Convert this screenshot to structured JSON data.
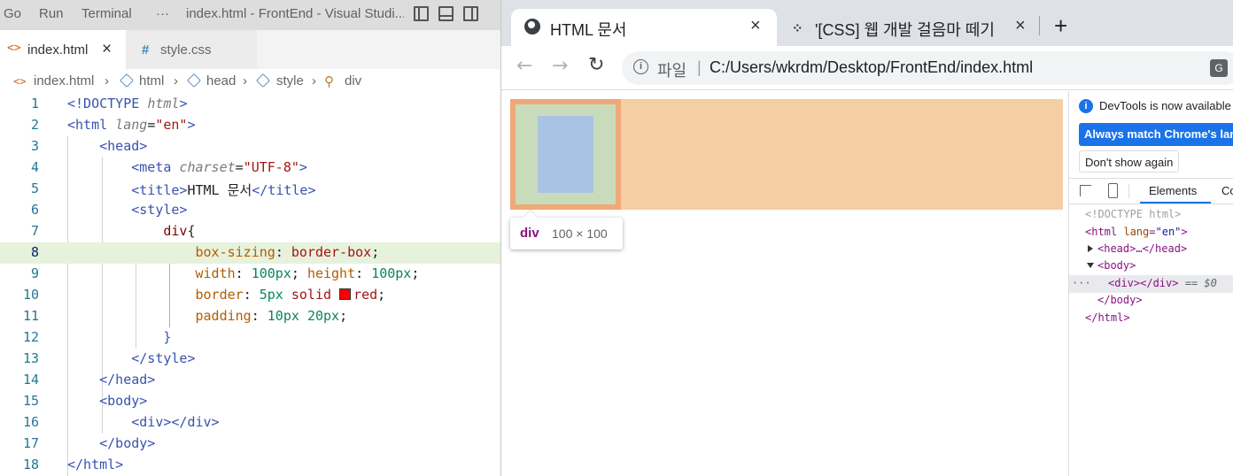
{
  "vscode": {
    "menu": [
      "Go",
      "Run",
      "Terminal",
      "···"
    ],
    "window_title": "index.html - FrontEnd - Visual Studi...",
    "tabs": [
      {
        "label": "index.html",
        "icon": "html-brackets-icon",
        "close": "×"
      },
      {
        "label": "style.css",
        "icon": "hash-icon"
      }
    ],
    "breadcrumb": [
      "index.html",
      "html",
      "head",
      "style",
      "div"
    ],
    "lines": [
      {
        "num": "1",
        "tokens": [
          {
            "t": "<!DOCTYPE ",
            "c": "c-tag"
          },
          {
            "t": "html",
            "c": "c-attr"
          },
          {
            "t": ">",
            "c": "c-tag"
          }
        ]
      },
      {
        "num": "2",
        "tokens": [
          {
            "t": "<html ",
            "c": "c-tag"
          },
          {
            "t": "lang",
            "c": "c-attr"
          },
          {
            "t": "=",
            "c": "c-text"
          },
          {
            "t": "\"en\"",
            "c": "c-str"
          },
          {
            "t": ">",
            "c": "c-tag"
          }
        ]
      },
      {
        "num": "3",
        "tokens": [
          {
            "t": "    ",
            "c": "c-text"
          },
          {
            "t": "<head>",
            "c": "c-tag"
          }
        ]
      },
      {
        "num": "4",
        "tokens": [
          {
            "t": "        ",
            "c": "c-text"
          },
          {
            "t": "<meta ",
            "c": "c-tag"
          },
          {
            "t": "charset",
            "c": "c-attr"
          },
          {
            "t": "=",
            "c": "c-text"
          },
          {
            "t": "\"UTF-8\"",
            "c": "c-str"
          },
          {
            "t": ">",
            "c": "c-tag"
          }
        ]
      },
      {
        "num": "5",
        "tokens": [
          {
            "t": "        ",
            "c": "c-text"
          },
          {
            "t": "<title>",
            "c": "c-tag"
          },
          {
            "t": "HTML 문서",
            "c": "c-text"
          },
          {
            "t": "</title>",
            "c": "c-tag"
          }
        ]
      },
      {
        "num": "6",
        "tokens": [
          {
            "t": "        ",
            "c": "c-text"
          },
          {
            "t": "<style>",
            "c": "c-tag"
          }
        ]
      },
      {
        "num": "7",
        "tokens": [
          {
            "t": "            ",
            "c": "c-text"
          },
          {
            "t": "div",
            "c": "t-punct"
          },
          {
            "t": "{",
            "c": "c-text"
          }
        ]
      },
      {
        "num": "8",
        "tokens": [
          {
            "t": "                ",
            "c": "c-text"
          },
          {
            "t": "box-sizing",
            "c": "c-prop"
          },
          {
            "t": ": ",
            "c": "c-text"
          },
          {
            "t": "border-box",
            "c": "c-val"
          },
          {
            "t": ";",
            "c": "c-text"
          }
        ]
      },
      {
        "num": "9",
        "tokens": [
          {
            "t": "                ",
            "c": "c-text"
          },
          {
            "t": "width",
            "c": "c-prop"
          },
          {
            "t": ": ",
            "c": "c-text"
          },
          {
            "t": "100px",
            "c": "c-num"
          },
          {
            "t": "; ",
            "c": "c-text"
          },
          {
            "t": "height",
            "c": "c-prop"
          },
          {
            "t": ": ",
            "c": "c-text"
          },
          {
            "t": "100px",
            "c": "c-num"
          },
          {
            "t": ";",
            "c": "c-text"
          }
        ]
      },
      {
        "num": "10",
        "tokens": [
          {
            "t": "                ",
            "c": "c-text"
          },
          {
            "t": "border",
            "c": "c-prop"
          },
          {
            "t": ": ",
            "c": "c-text"
          },
          {
            "t": "5px",
            "c": "c-num"
          },
          {
            "t": " solid ",
            "c": "c-val"
          },
          {
            "t": "",
            "c": "swatch"
          },
          {
            "t": "red",
            "c": "c-val"
          },
          {
            "t": ";",
            "c": "c-text"
          }
        ]
      },
      {
        "num": "11",
        "tokens": [
          {
            "t": "                ",
            "c": "c-text"
          },
          {
            "t": "padding",
            "c": "c-prop"
          },
          {
            "t": ": ",
            "c": "c-text"
          },
          {
            "t": "10px",
            "c": "c-num"
          },
          {
            "t": " ",
            "c": "c-text"
          },
          {
            "t": "20px",
            "c": "c-num"
          },
          {
            "t": ";",
            "c": "c-text"
          }
        ]
      },
      {
        "num": "12",
        "tokens": [
          {
            "t": "            ",
            "c": "c-text"
          },
          {
            "t": "}",
            "c": "c-tag"
          }
        ]
      },
      {
        "num": "13",
        "tokens": [
          {
            "t": "        ",
            "c": "c-text"
          },
          {
            "t": "</style>",
            "c": "c-tag"
          }
        ]
      },
      {
        "num": "14",
        "tokens": [
          {
            "t": "    ",
            "c": "c-text"
          },
          {
            "t": "</head>",
            "c": "c-tag"
          }
        ]
      },
      {
        "num": "15",
        "tokens": [
          {
            "t": "    ",
            "c": "c-text"
          },
          {
            "t": "<body>",
            "c": "c-tag"
          }
        ]
      },
      {
        "num": "16",
        "tokens": [
          {
            "t": "        ",
            "c": "c-text"
          },
          {
            "t": "<div></div>",
            "c": "c-tag"
          }
        ]
      },
      {
        "num": "17",
        "tokens": [
          {
            "t": "    ",
            "c": "c-text"
          },
          {
            "t": "</body>",
            "c": "c-tag"
          }
        ]
      },
      {
        "num": "18",
        "tokens": [
          {
            "t": "</html>",
            "c": "c-tag"
          }
        ]
      }
    ],
    "highlight_line": "8"
  },
  "chrome": {
    "tabs": [
      {
        "title": "HTML 문서",
        "icon": "globe-icon",
        "close": "×"
      },
      {
        "title": "'[CSS] 웹 개발 걸음마 떼기",
        "icon": "tistory-icon",
        "close": "×"
      }
    ],
    "new_tab": "+",
    "nav": {
      "back": "←",
      "forward": "→",
      "reload": "↻"
    },
    "address": {
      "scheme_label": "파일",
      "url": "C:/Users/wkrdm/Desktop/FrontEnd/index.html"
    },
    "tooltip": {
      "tag": "div",
      "size": "100 × 100"
    },
    "colors": {
      "margin": "#f3cfa3",
      "border": "#f0a878",
      "padding": "#c8dcbb",
      "content": "#a9c3e4"
    }
  },
  "devtools": {
    "info": "DevTools is now available",
    "match_button": "Always match Chrome's lang",
    "dont_show_button": "Don't show again",
    "tabs": [
      "Elements",
      "Co"
    ],
    "dom": {
      "doctype": "<!DOCTYPE html>",
      "html_open_tag": "<html ",
      "html_lang_attr": "lang",
      "html_lang_eq": "=",
      "html_lang_val": "\"en\"",
      "html_open_end": ">",
      "head": "<head>…</head>",
      "body_open": "<body>",
      "dots": "···",
      "div": "<div></div>",
      "div_ref": " == $0",
      "body_close": "</body>",
      "html_close": "</html>"
    }
  }
}
